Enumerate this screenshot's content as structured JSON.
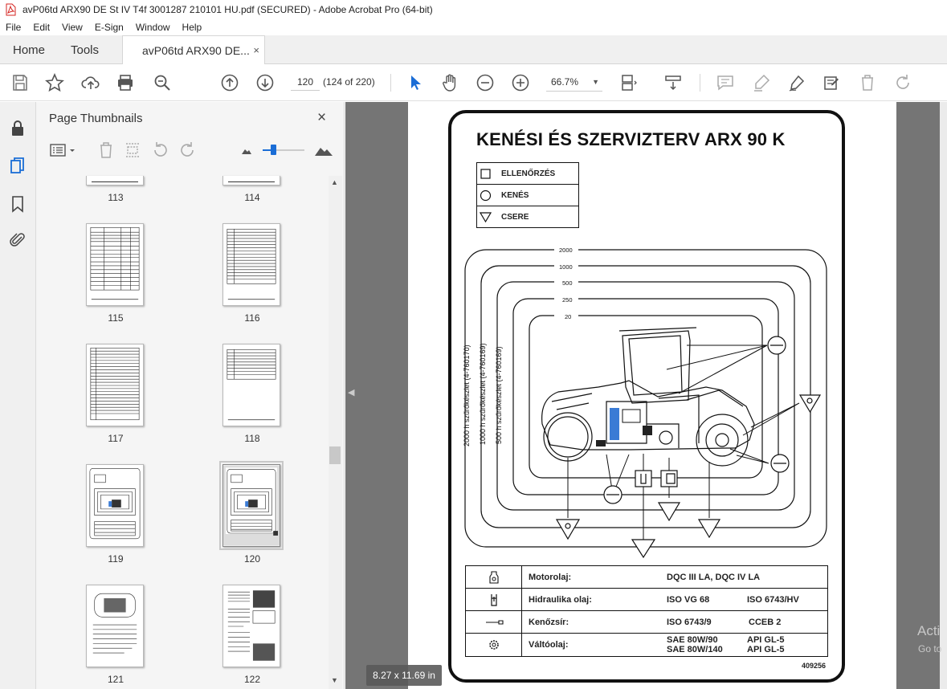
{
  "window": {
    "title": "avP06td ARX90 DE St IV T4f 3001287 210101 HU.pdf (SECURED) - Adobe Acrobat Pro (64-bit)"
  },
  "menu": [
    "File",
    "Edit",
    "View",
    "E-Sign",
    "Window",
    "Help"
  ],
  "tabs": {
    "home": "Home",
    "tools": "Tools",
    "doc": "avP06td ARX90 DE...",
    "close": "×"
  },
  "toolbar": {
    "page_number": "120",
    "page_count": "(124 of 220)",
    "zoom": "66.7%"
  },
  "panel": {
    "title": "Page Thumbnails",
    "close": "×",
    "thumbnails": [
      {
        "label": "113"
      },
      {
        "label": "114"
      },
      {
        "label": "115"
      },
      {
        "label": "116"
      },
      {
        "label": "117"
      },
      {
        "label": "118"
      },
      {
        "label": "119"
      },
      {
        "label": "120",
        "selected": true
      },
      {
        "label": "121"
      },
      {
        "label": "122"
      }
    ]
  },
  "page_size": "8.27 x 11.69 in",
  "watermark": {
    "line1": "Acti",
    "line2": "Go to"
  },
  "document": {
    "title": "KENÉSI ÉS SZERVIZTERV ARX 90 K",
    "legend": [
      {
        "icon": "square",
        "label": "ELLENŐRZÉS"
      },
      {
        "icon": "circle",
        "label": "KENÉS"
      },
      {
        "icon": "triangle",
        "label": "CSERE"
      }
    ],
    "hours": [
      "2000",
      "1000",
      "500",
      "250",
      "20"
    ],
    "filter_kits": [
      "2000 h szűrőkészlet (4-760170)",
      "1000 h szűrőkészlet (4-760169)",
      "500 h szűrőkészlet (4-760169)"
    ],
    "lubricants": [
      {
        "icon": "oil-can-icon",
        "label": "Motorolaj:",
        "v1": "DQC III LA, DQC IV LA",
        "v2": ""
      },
      {
        "icon": "hydraulic-icon",
        "label": "Hidraulika olaj:",
        "v1": "ISO VG 68",
        "v2": "ISO 6743/HV"
      },
      {
        "icon": "grease-icon",
        "label": "Kenőzsír:",
        "v1": "ISO 6743/9",
        "v2": "CCEB 2"
      },
      {
        "icon": "gear-icon",
        "label": "Váltóolaj:",
        "v1": "SAE 80W/90",
        "v2": "API GL-5",
        "v3": "SAE 80W/140",
        "v4": "API GL-5"
      }
    ],
    "doc_number": "409256"
  }
}
